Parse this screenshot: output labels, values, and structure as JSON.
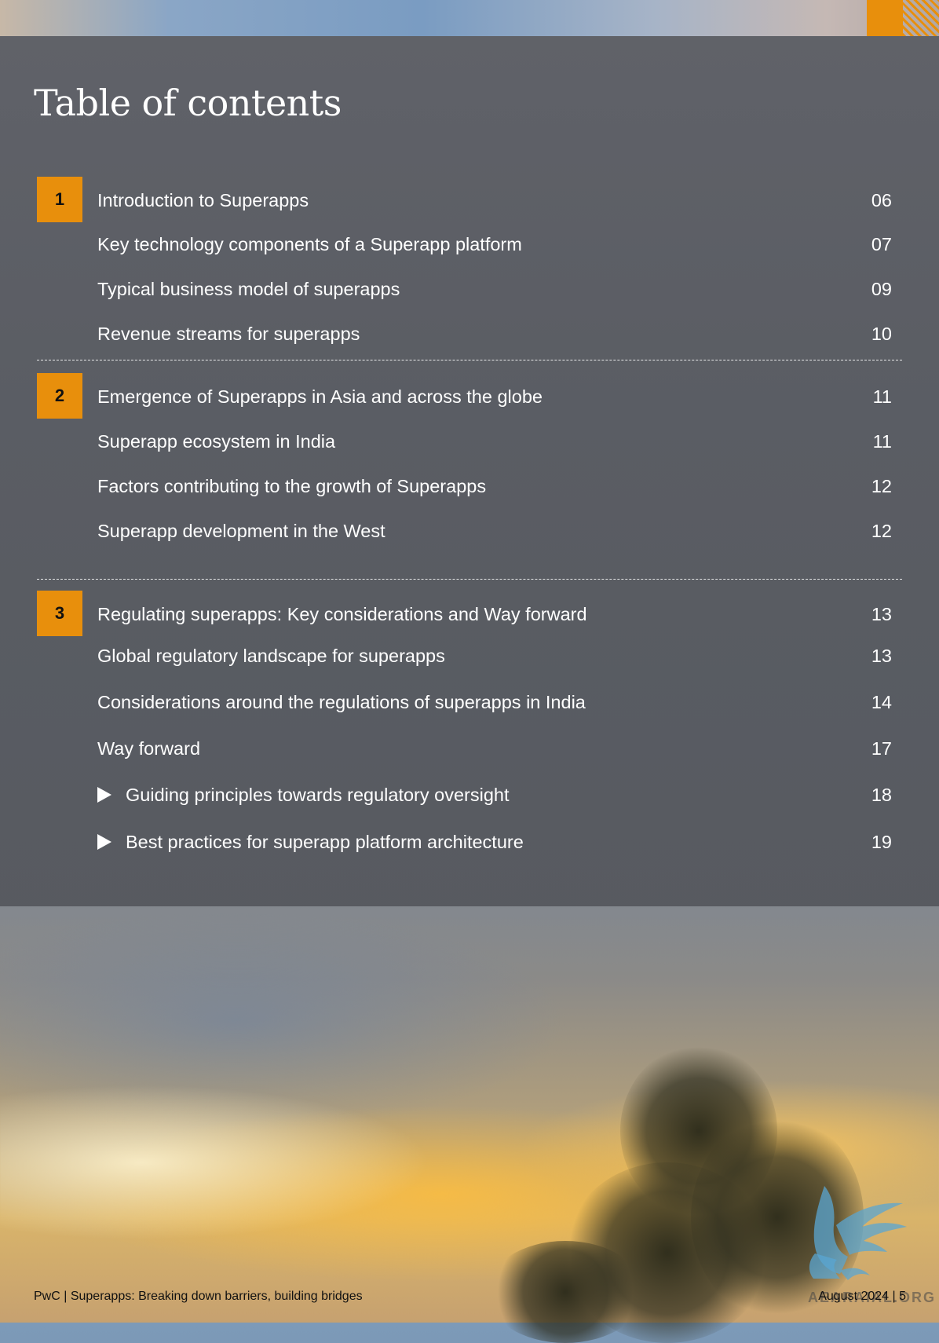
{
  "header": {
    "title": "Table of contents"
  },
  "sections": [
    {
      "number": "1",
      "entries": [
        {
          "text": "Introduction to Superapps",
          "page": "06"
        },
        {
          "text": "Key technology components of a Superapp platform",
          "page": "07"
        },
        {
          "text": "Typical business model of superapps",
          "page": "09"
        },
        {
          "text": "Revenue streams for superapps",
          "page": "10"
        }
      ]
    },
    {
      "number": "2",
      "entries": [
        {
          "text": "Emergence of Superapps in Asia and across the globe",
          "page": "11"
        },
        {
          "text": "Superapp ecosystem in India",
          "page": "11"
        },
        {
          "text": "Factors contributing to the growth of Superapps",
          "page": "12"
        },
        {
          "text": "Superapp development in the West",
          "page": "12"
        }
      ]
    },
    {
      "number": "3",
      "entries": [
        {
          "text": "Regulating superapps: Key considerations and Way forward",
          "page": "13"
        },
        {
          "text": "Global regulatory landscape for superapps",
          "page": "13"
        },
        {
          "text": "Considerations around the regulations of superapps in India",
          "page": "14"
        },
        {
          "text": "Way forward",
          "page": "17"
        },
        {
          "text": "Guiding principles towards regulatory oversight",
          "page": "18",
          "bullet": "triangle-icon"
        },
        {
          "text": "Best practices for superapp platform architecture",
          "page": "19",
          "bullet": "triangle-icon"
        }
      ]
    }
  ],
  "footer": {
    "left": "PwC | Superapps: Breaking down barriers, building bridges",
    "right": "August 2024 | 5"
  },
  "watermark": {
    "text": "AEARAIAL.ORG",
    "icon": "griffin-logo"
  },
  "colors": {
    "accent": "#e88f0c",
    "panel": "#5c5e64",
    "text": "#ffffff"
  }
}
